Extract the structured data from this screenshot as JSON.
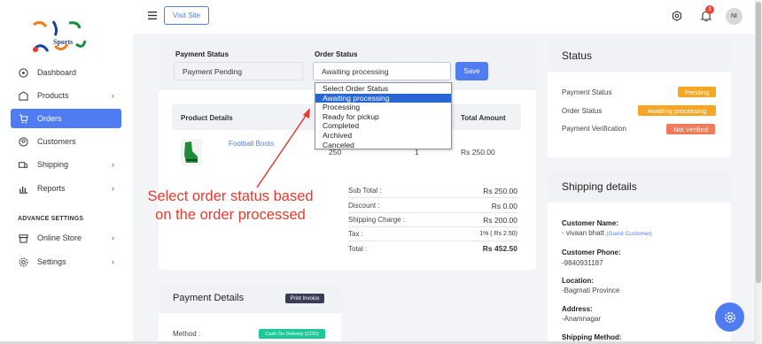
{
  "sidebar": {
    "logo_text": "Sports",
    "items": [
      {
        "label": "Dashboard",
        "icon": "dashboard-icon"
      },
      {
        "label": "Products",
        "icon": "products-icon"
      },
      {
        "label": "Orders",
        "icon": "orders-icon"
      },
      {
        "label": "Customers",
        "icon": "customers-icon"
      },
      {
        "label": "Shipping",
        "icon": "shipping-icon"
      },
      {
        "label": "Reports",
        "icon": "reports-icon"
      },
      {
        "label": "Online Store",
        "icon": "store-icon"
      },
      {
        "label": "Settings",
        "icon": "gear-icon"
      }
    ],
    "section_label": "ADVANCE SETTINGS",
    "active_color": "#4f7cf0"
  },
  "topbar": {
    "visit_site": "Visit Site",
    "notification_count": "3",
    "avatar_initials": "NI"
  },
  "order_form": {
    "payment_status_label": "Payment Status",
    "payment_status_value": "Payment Pending",
    "order_status_label": "Order Status",
    "order_status_value": "Awaiting processing",
    "save_label": "Save",
    "options": [
      "Select Order Status",
      "Awaiting processing",
      "Processing",
      "Ready for pickup",
      "Completed",
      "Archived",
      "Canceled"
    ]
  },
  "table": {
    "headers": {
      "product": "Product Details",
      "total": "Total Amount"
    },
    "row": {
      "name": "Football Boots",
      "price": "250",
      "qty": "1",
      "total": "Rs 250.00"
    }
  },
  "summary": {
    "subtotal_label": "Sub Total :",
    "subtotal": "Rs 250.00",
    "discount_label": "Discount :",
    "discount": "Rs 0.00",
    "shipping_label": "Shipping Charge :",
    "shipping": "Rs 200.00",
    "tax_label": "Tax :",
    "tax": "1% ( Rs 2.50)",
    "total_label": "Total :",
    "total": "Rs 452.50"
  },
  "annotation": "Select order status based on the order processed",
  "payment_details": {
    "title": "Payment Details",
    "print_label": "Print Invoice",
    "method_label": "Method :",
    "method_value": "Cash On Delivery (COD)"
  },
  "status": {
    "title": "Status",
    "payment_status_label": "Payment Status",
    "payment_status_value": "Pending",
    "order_status_label": "Order Status",
    "order_status_value": "Awaiting processing",
    "verification_label": "Payment Verification",
    "verification_value": "Not Verified",
    "colors": {
      "pending": "#f5a623",
      "awaiting": "#f5a623",
      "not_verified": "#ef7b5a"
    }
  },
  "shipping": {
    "title": "Shipping details",
    "customer_name_label": "Customer Name:",
    "customer_name": "- vivaan bhatt",
    "guest_tag": "(Guest Customer)",
    "phone_label": "Customer Phone:",
    "phone": "-9840931187",
    "location_label": "Location:",
    "location": "-Bagmati Province",
    "address_label": "Address:",
    "address": "-Anamnagar",
    "method_label": "Shipping Method:"
  }
}
